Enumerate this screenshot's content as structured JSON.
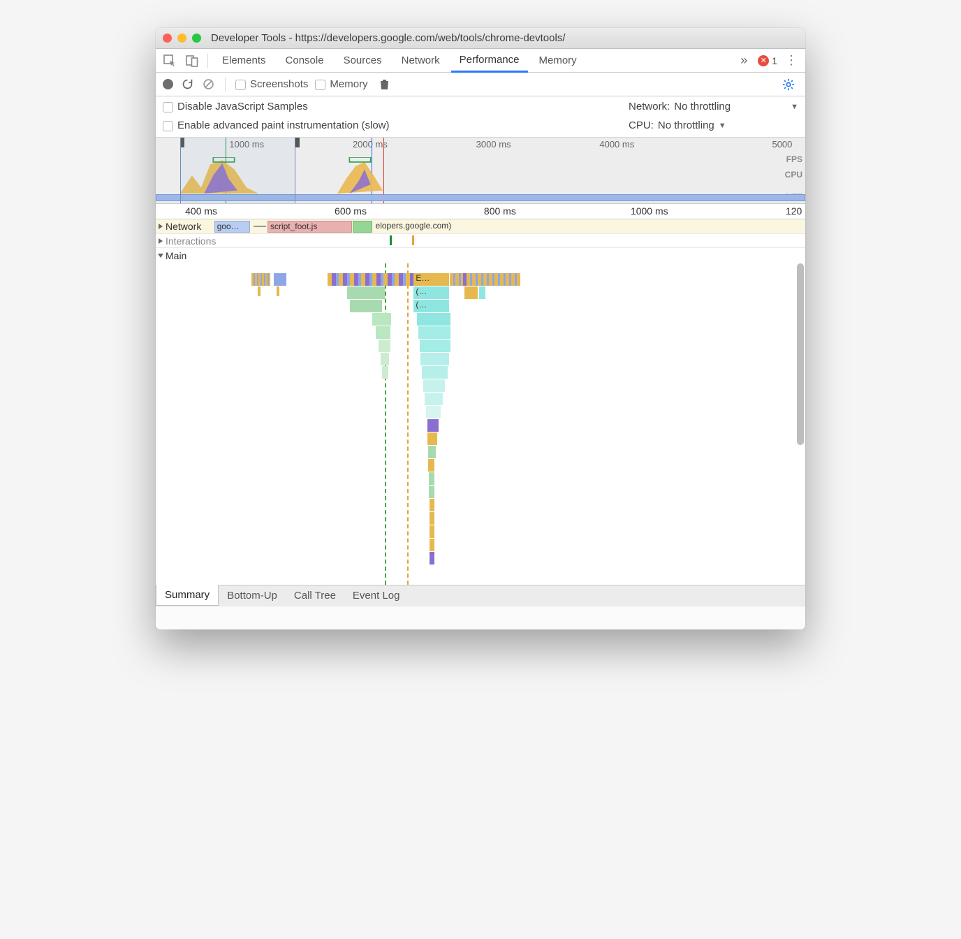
{
  "window": {
    "title": "Developer Tools - https://developers.google.com/web/tools/chrome-devtools/"
  },
  "tabs": {
    "items": [
      "Elements",
      "Console",
      "Sources",
      "Network",
      "Performance",
      "Memory"
    ],
    "active": "Performance",
    "overflow_glyph": "»",
    "error_count": "1"
  },
  "perf_toolbar": {
    "screenshots": "Screenshots",
    "memory": "Memory"
  },
  "settings": {
    "disable_js": "Disable JavaScript Samples",
    "paint_instr": "Enable advanced paint instrumentation (slow)",
    "network_label": "Network:",
    "network_value": "No throttling",
    "cpu_label": "CPU:",
    "cpu_value": "No throttling"
  },
  "overview": {
    "ticks": [
      "1000 ms",
      "2000 ms",
      "3000 ms",
      "4000 ms",
      "5000"
    ],
    "labels": {
      "fps": "FPS",
      "cpu": "CPU",
      "net": "NET"
    }
  },
  "detail_ruler": [
    "400 ms",
    "600 ms",
    "800 ms",
    "1000 ms",
    "120"
  ],
  "tracks": {
    "network": "Network",
    "network_item1": "goo…",
    "network_item2": "script_foot.js",
    "network_item3": "elopers.google.com)",
    "interactions": "Interactions",
    "main": "Main",
    "flame_e": "E…",
    "flame_p1": "(…",
    "flame_p2": "(…"
  },
  "bottom_tabs": [
    "Summary",
    "Bottom-Up",
    "Call Tree",
    "Event Log"
  ]
}
